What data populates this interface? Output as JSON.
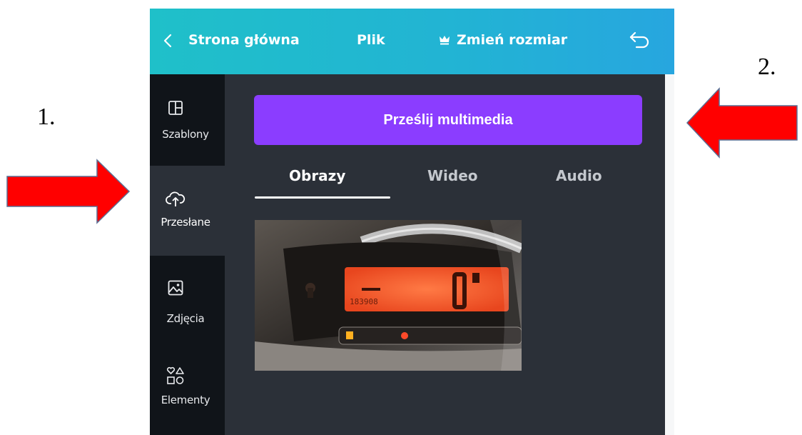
{
  "annotations": {
    "label_1": "1.",
    "label_2": "2."
  },
  "topbar": {
    "back_label": "Strona główna",
    "file_label": "Plik",
    "resize_label": "Zmień rozmiar"
  },
  "sidebar": {
    "items": [
      {
        "label": "Szablony",
        "icon": "layout-icon"
      },
      {
        "label": "Przesłane",
        "icon": "cloud-upload-icon"
      },
      {
        "label": "Zdjęcia",
        "icon": "image-icon"
      },
      {
        "label": "Elementy",
        "icon": "shapes-icon"
      }
    ]
  },
  "panel": {
    "upload_button": "Prześlij multimedia",
    "tabs": [
      "Obrazy",
      "Wideo",
      "Audio"
    ],
    "active_tab": "Obrazy",
    "dashboard_reading": "183908"
  },
  "colors": {
    "topbar_start": "#1fc0c9",
    "topbar_end": "#27a6df",
    "sidebar_bg": "#101419",
    "panel_bg": "#2b3038",
    "accent_purple": "#8b3dff",
    "arrow_red": "#ff0000"
  }
}
